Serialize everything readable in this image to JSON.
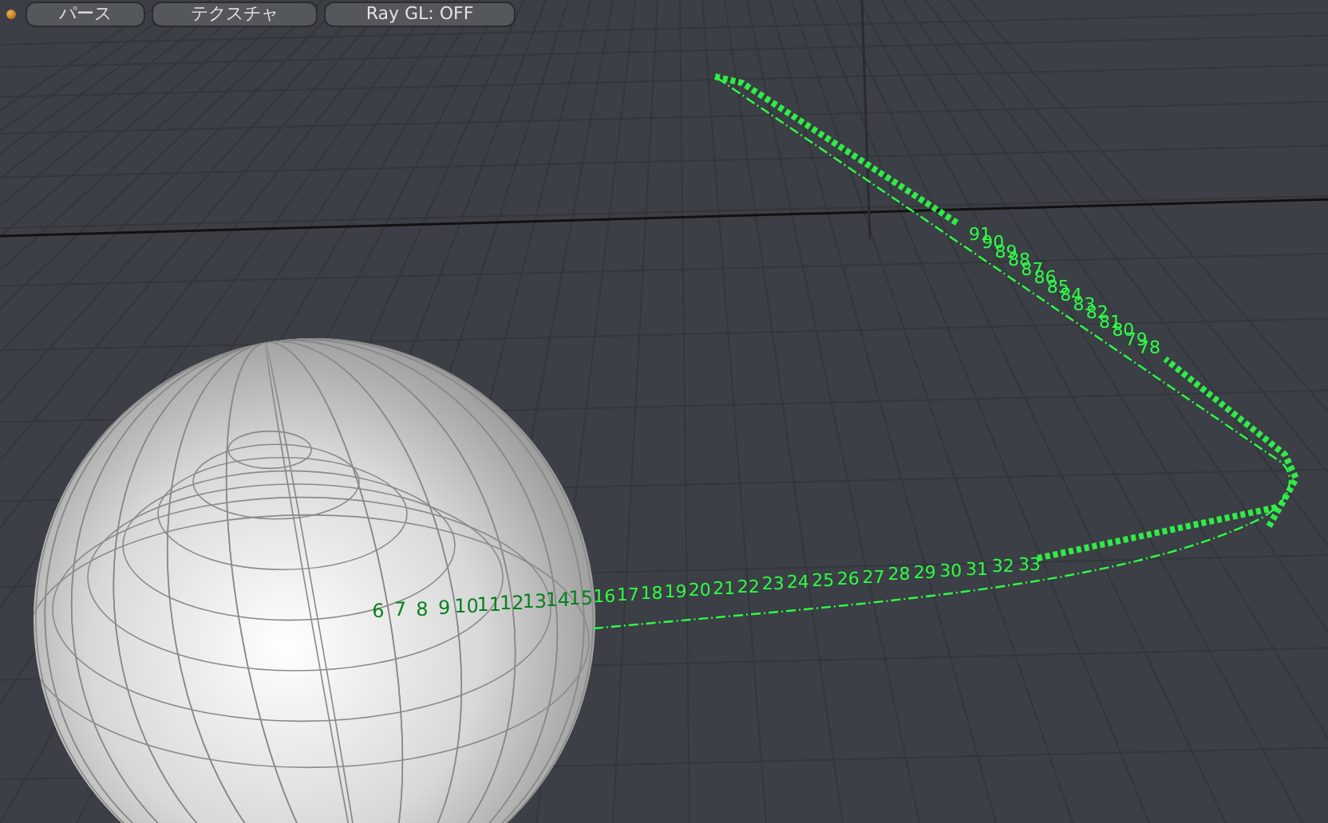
{
  "toolbar": {
    "buttons": [
      {
        "label": "パース"
      },
      {
        "label": "テクスチャ"
      },
      {
        "label": "Ray GL: OFF"
      }
    ]
  },
  "viewport": {
    "near_labels": [
      "6",
      "7",
      "8",
      "9",
      "10",
      "11",
      "12",
      "13",
      "14",
      "15",
      "16",
      "17",
      "18",
      "19",
      "20",
      "21",
      "22",
      "23",
      "24",
      "25",
      "26",
      "27",
      "28",
      "29",
      "30",
      "31",
      "32",
      "33"
    ],
    "far_labels": [
      "91",
      "90",
      "89",
      "88",
      "87",
      "86",
      "85",
      "84",
      "83",
      "82",
      "81",
      "80",
      "79",
      "78"
    ]
  }
}
